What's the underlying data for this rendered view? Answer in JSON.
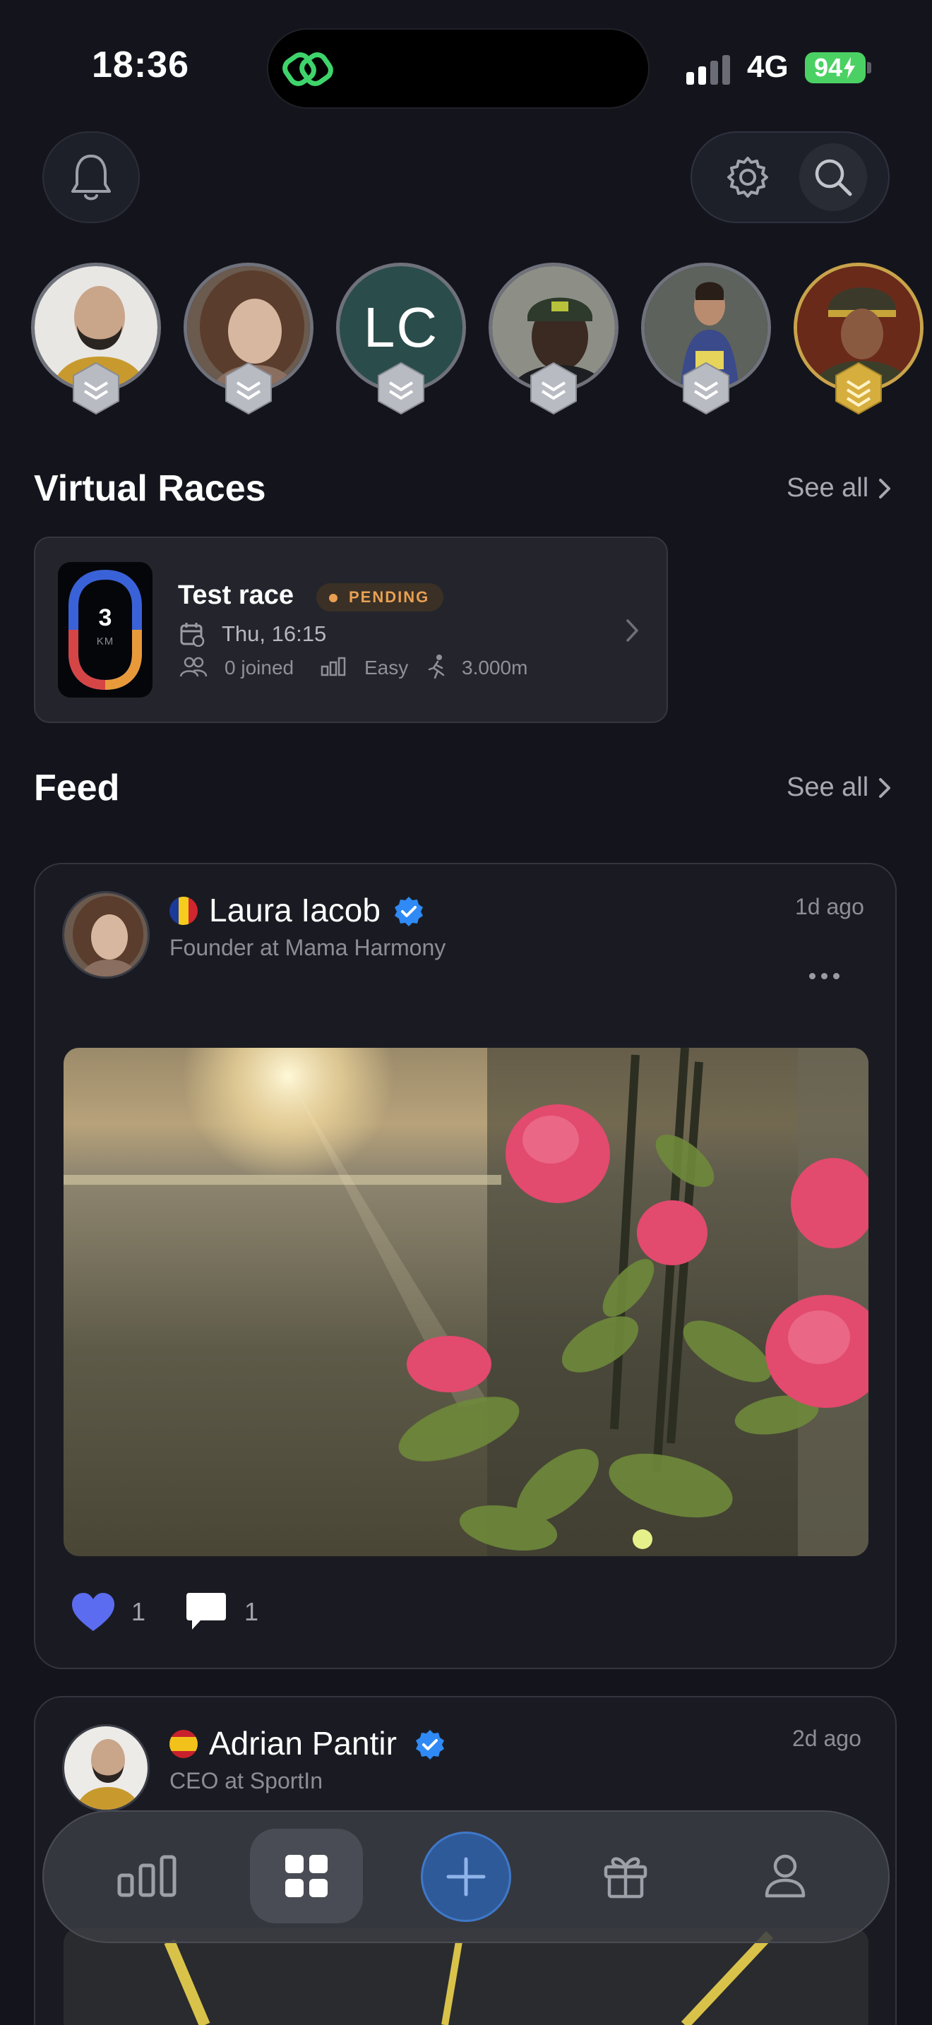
{
  "status_bar": {
    "time": "18:36",
    "network": "4G",
    "battery": "94",
    "battery_color": "#4bd163"
  },
  "header": {
    "notifications_icon": "bell-icon",
    "settings_icon": "gear-icon",
    "search_icon": "search-icon"
  },
  "stories": [
    {
      "type": "photo",
      "description_icon": "avatar-bald-bearded-man",
      "badge": "silver"
    },
    {
      "type": "photo",
      "description_icon": "avatar-curly-hair-woman",
      "badge": "silver"
    },
    {
      "type": "initials",
      "initials": "LC",
      "badge": "silver"
    },
    {
      "type": "photo",
      "description_icon": "avatar-man-in-cap",
      "badge": "silver"
    },
    {
      "type": "photo",
      "description_icon": "avatar-runner-woman",
      "badge": "silver"
    },
    {
      "type": "photo",
      "description_icon": "avatar-uniformed-man",
      "badge": "gold"
    }
  ],
  "virtual_races": {
    "title": "Virtual Races",
    "see_all": "See all",
    "race": {
      "distance_value": "3",
      "distance_unit": "KM",
      "title": "Test race",
      "status": "PENDING",
      "date": "Thu, 16:15",
      "joined": "0 joined",
      "difficulty": "Easy",
      "distance": "3.000m"
    }
  },
  "feed": {
    "title": "Feed",
    "see_all": "See all",
    "posts": [
      {
        "author": "Laura Iacob",
        "subtitle": "Founder at Mama Harmony",
        "time": "1d ago",
        "flag": "romania-flag-icon",
        "likes": "1",
        "comments": "1"
      },
      {
        "author": "Adrian Pantir",
        "subtitle": "CEO at SportIn",
        "time": "2d ago",
        "flag": "spain-flag-icon"
      }
    ]
  },
  "bottom_nav": {
    "items": [
      "stats-icon",
      "grid-icon",
      "plus-icon",
      "gift-icon",
      "profile-icon"
    ],
    "active": "grid-icon"
  }
}
